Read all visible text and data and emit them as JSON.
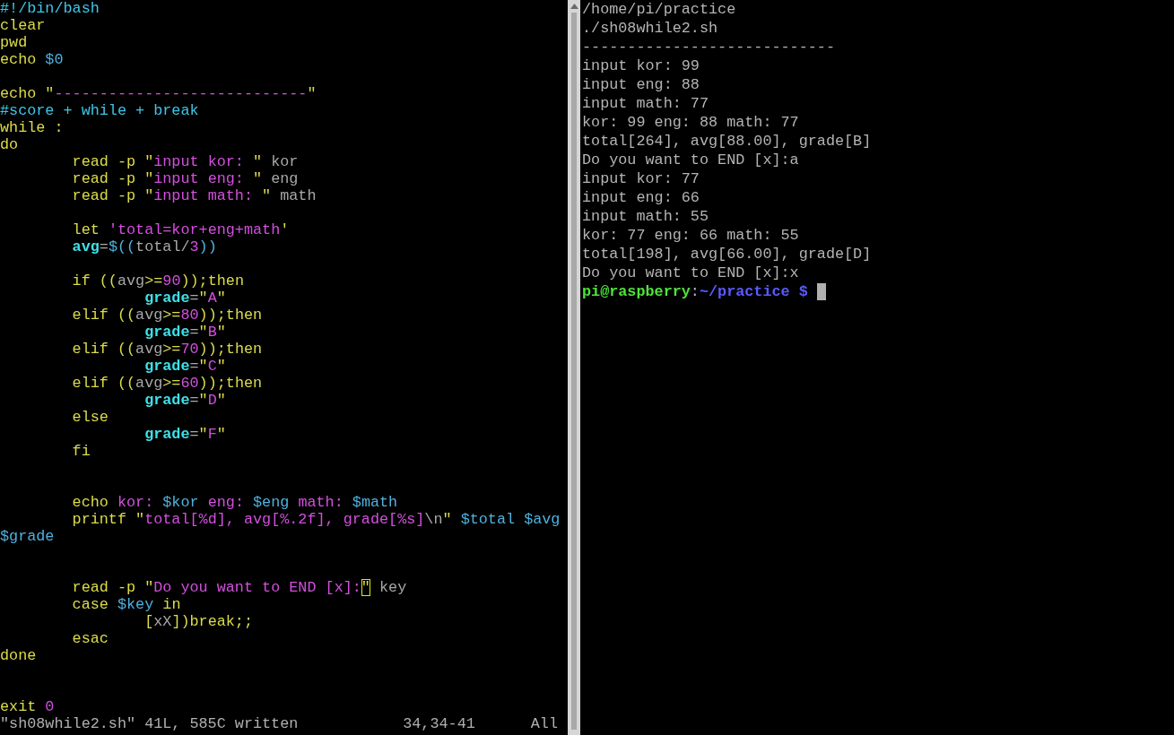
{
  "editor": {
    "lines": [
      {
        "kind": "code",
        "segments": [
          {
            "kind": "comment",
            "text": "#!/bin/bash"
          }
        ]
      },
      {
        "kind": "code",
        "segments": [
          {
            "kind": "keyword",
            "text": "clear"
          }
        ]
      },
      {
        "kind": "code",
        "segments": [
          {
            "kind": "keyword",
            "text": "pwd"
          }
        ]
      },
      {
        "kind": "code",
        "segments": [
          {
            "kind": "keyword",
            "text": "echo "
          },
          {
            "kind": "variable",
            "text": "$0"
          }
        ]
      },
      {
        "kind": "blank"
      },
      {
        "kind": "code",
        "segments": [
          {
            "kind": "keyword",
            "text": "echo \""
          },
          {
            "kind": "string",
            "text": "----------------------------"
          },
          {
            "kind": "keyword",
            "text": "\""
          }
        ]
      },
      {
        "kind": "code",
        "segments": [
          {
            "kind": "comment",
            "text": "#score + while + break"
          }
        ]
      },
      {
        "kind": "code",
        "segments": [
          {
            "kind": "keyword",
            "text": "while :"
          }
        ]
      },
      {
        "kind": "code",
        "segments": [
          {
            "kind": "keyword",
            "text": "do"
          }
        ]
      },
      {
        "kind": "code",
        "segments": [
          {
            "kind": "keyword",
            "text": "\tread -p \""
          },
          {
            "kind": "string",
            "text": "input kor: "
          },
          {
            "kind": "keyword",
            "text": "\""
          },
          {
            "kind": "plain",
            "text": " kor"
          }
        ]
      },
      {
        "kind": "code",
        "segments": [
          {
            "kind": "keyword",
            "text": "\tread -p \""
          },
          {
            "kind": "string",
            "text": "input eng: "
          },
          {
            "kind": "keyword",
            "text": "\""
          },
          {
            "kind": "plain",
            "text": " eng"
          }
        ]
      },
      {
        "kind": "code",
        "segments": [
          {
            "kind": "keyword",
            "text": "\tread -p \""
          },
          {
            "kind": "string",
            "text": "input math: "
          },
          {
            "kind": "keyword",
            "text": "\""
          },
          {
            "kind": "plain",
            "text": " math"
          }
        ]
      },
      {
        "kind": "blank"
      },
      {
        "kind": "code",
        "segments": [
          {
            "kind": "keyword",
            "text": "\tlet "
          },
          {
            "kind": "string",
            "text": "'total=kor+eng+math"
          },
          {
            "kind": "keyword",
            "text": "'"
          }
        ]
      },
      {
        "kind": "code",
        "segments": [
          {
            "kind": "assign",
            "text": "\tavg"
          },
          {
            "kind": "plain",
            "text": "="
          },
          {
            "kind": "variable",
            "text": "$(("
          },
          {
            "kind": "plain",
            "text": "total/"
          },
          {
            "kind": "string",
            "text": "3"
          },
          {
            "kind": "variable",
            "text": "))"
          }
        ]
      },
      {
        "kind": "blank"
      },
      {
        "kind": "code",
        "segments": [
          {
            "kind": "keyword",
            "text": "\tif (("
          },
          {
            "kind": "plain",
            "text": "avg"
          },
          {
            "kind": "keyword",
            "text": ">="
          },
          {
            "kind": "string",
            "text": "90"
          },
          {
            "kind": "keyword",
            "text": "));then"
          }
        ]
      },
      {
        "kind": "code",
        "segments": [
          {
            "kind": "assign",
            "text": "\t\tgrade"
          },
          {
            "kind": "plain",
            "text": "="
          },
          {
            "kind": "keyword",
            "text": "\""
          },
          {
            "kind": "string",
            "text": "A"
          },
          {
            "kind": "keyword",
            "text": "\""
          }
        ]
      },
      {
        "kind": "code",
        "segments": [
          {
            "kind": "keyword",
            "text": "\telif (("
          },
          {
            "kind": "plain",
            "text": "avg"
          },
          {
            "kind": "keyword",
            "text": ">="
          },
          {
            "kind": "string",
            "text": "80"
          },
          {
            "kind": "keyword",
            "text": "));then"
          }
        ]
      },
      {
        "kind": "code",
        "segments": [
          {
            "kind": "assign",
            "text": "\t\tgrade"
          },
          {
            "kind": "plain",
            "text": "="
          },
          {
            "kind": "keyword",
            "text": "\""
          },
          {
            "kind": "string",
            "text": "B"
          },
          {
            "kind": "keyword",
            "text": "\""
          }
        ]
      },
      {
        "kind": "code",
        "segments": [
          {
            "kind": "keyword",
            "text": "\telif (("
          },
          {
            "kind": "plain",
            "text": "avg"
          },
          {
            "kind": "keyword",
            "text": ">="
          },
          {
            "kind": "string",
            "text": "70"
          },
          {
            "kind": "keyword",
            "text": "));then"
          }
        ]
      },
      {
        "kind": "code",
        "segments": [
          {
            "kind": "assign",
            "text": "\t\tgrade"
          },
          {
            "kind": "plain",
            "text": "="
          },
          {
            "kind": "keyword",
            "text": "\""
          },
          {
            "kind": "string",
            "text": "C"
          },
          {
            "kind": "keyword",
            "text": "\""
          }
        ]
      },
      {
        "kind": "code",
        "segments": [
          {
            "kind": "keyword",
            "text": "\telif (("
          },
          {
            "kind": "plain",
            "text": "avg"
          },
          {
            "kind": "keyword",
            "text": ">="
          },
          {
            "kind": "string",
            "text": "60"
          },
          {
            "kind": "keyword",
            "text": "));then"
          }
        ]
      },
      {
        "kind": "code",
        "segments": [
          {
            "kind": "assign",
            "text": "\t\tgrade"
          },
          {
            "kind": "plain",
            "text": "="
          },
          {
            "kind": "keyword",
            "text": "\""
          },
          {
            "kind": "string",
            "text": "D"
          },
          {
            "kind": "keyword",
            "text": "\""
          }
        ]
      },
      {
        "kind": "code",
        "segments": [
          {
            "kind": "keyword",
            "text": "\telse"
          }
        ]
      },
      {
        "kind": "code",
        "segments": [
          {
            "kind": "assign",
            "text": "\t\tgrade"
          },
          {
            "kind": "plain",
            "text": "="
          },
          {
            "kind": "keyword",
            "text": "\""
          },
          {
            "kind": "string",
            "text": "F"
          },
          {
            "kind": "keyword",
            "text": "\""
          }
        ]
      },
      {
        "kind": "code",
        "segments": [
          {
            "kind": "keyword",
            "text": "\tfi"
          }
        ]
      },
      {
        "kind": "blank"
      },
      {
        "kind": "blank"
      },
      {
        "kind": "code",
        "segments": [
          {
            "kind": "keyword",
            "text": "\techo "
          },
          {
            "kind": "string",
            "text": "kor: "
          },
          {
            "kind": "variable",
            "text": "$kor"
          },
          {
            "kind": "string",
            "text": " eng: "
          },
          {
            "kind": "variable",
            "text": "$eng"
          },
          {
            "kind": "string",
            "text": " math: "
          },
          {
            "kind": "variable",
            "text": "$math"
          }
        ]
      },
      {
        "kind": "code",
        "segments": [
          {
            "kind": "keyword",
            "text": "\tprintf \""
          },
          {
            "kind": "string",
            "text": "total[%d], avg[%.2f], grade[%s]"
          },
          {
            "kind": "plain",
            "text": "\\n"
          },
          {
            "kind": "keyword",
            "text": "\" "
          },
          {
            "kind": "variable",
            "text": "$total $avg"
          }
        ]
      },
      {
        "kind": "code",
        "segments": [
          {
            "kind": "variable",
            "text": "$grade"
          }
        ]
      },
      {
        "kind": "blank"
      },
      {
        "kind": "blank"
      },
      {
        "kind": "code",
        "segments": [
          {
            "kind": "keyword",
            "text": "\tread -p \""
          },
          {
            "kind": "string",
            "text": "Do you want to END [x]:"
          },
          {
            "kind": "cursor",
            "text": "\""
          },
          {
            "kind": "plain",
            "text": " key"
          }
        ]
      },
      {
        "kind": "code",
        "segments": [
          {
            "kind": "keyword",
            "text": "\tcase "
          },
          {
            "kind": "variable",
            "text": "$key"
          },
          {
            "kind": "keyword",
            "text": " in"
          }
        ]
      },
      {
        "kind": "code",
        "segments": [
          {
            "kind": "keyword",
            "text": "\t\t["
          },
          {
            "kind": "plain",
            "text": "xX"
          },
          {
            "kind": "keyword",
            "text": "])break;;"
          }
        ]
      },
      {
        "kind": "code",
        "segments": [
          {
            "kind": "keyword",
            "text": "\tesac"
          }
        ]
      },
      {
        "kind": "code",
        "segments": [
          {
            "kind": "keyword",
            "text": "done"
          }
        ]
      },
      {
        "kind": "blank"
      },
      {
        "kind": "blank"
      },
      {
        "kind": "code",
        "segments": [
          {
            "kind": "keyword",
            "text": "exit "
          },
          {
            "kind": "string",
            "text": "0"
          }
        ]
      }
    ],
    "status_bar": {
      "message": "\"sh08while2.sh\" 41L, 585C written",
      "position": "34,34-41",
      "scroll": "All"
    }
  },
  "terminal": {
    "output": [
      "/home/pi/practice",
      "./sh08while2.sh",
      "----------------------------",
      "input kor: 99",
      "input eng: 88",
      "input math: 77",
      "kor: 99 eng: 88 math: 77",
      "total[264], avg[88.00], grade[B]",
      "Do you want to END [x]:a",
      "input kor: 77",
      "input eng: 66",
      "input math: 55",
      "kor: 77 eng: 66 math: 55",
      "total[198], avg[66.00], grade[D]",
      "Do you want to END [x]:x"
    ],
    "prompt": {
      "user_host": "pi@raspberry",
      "separator": ":",
      "path": "~/practice $"
    }
  }
}
